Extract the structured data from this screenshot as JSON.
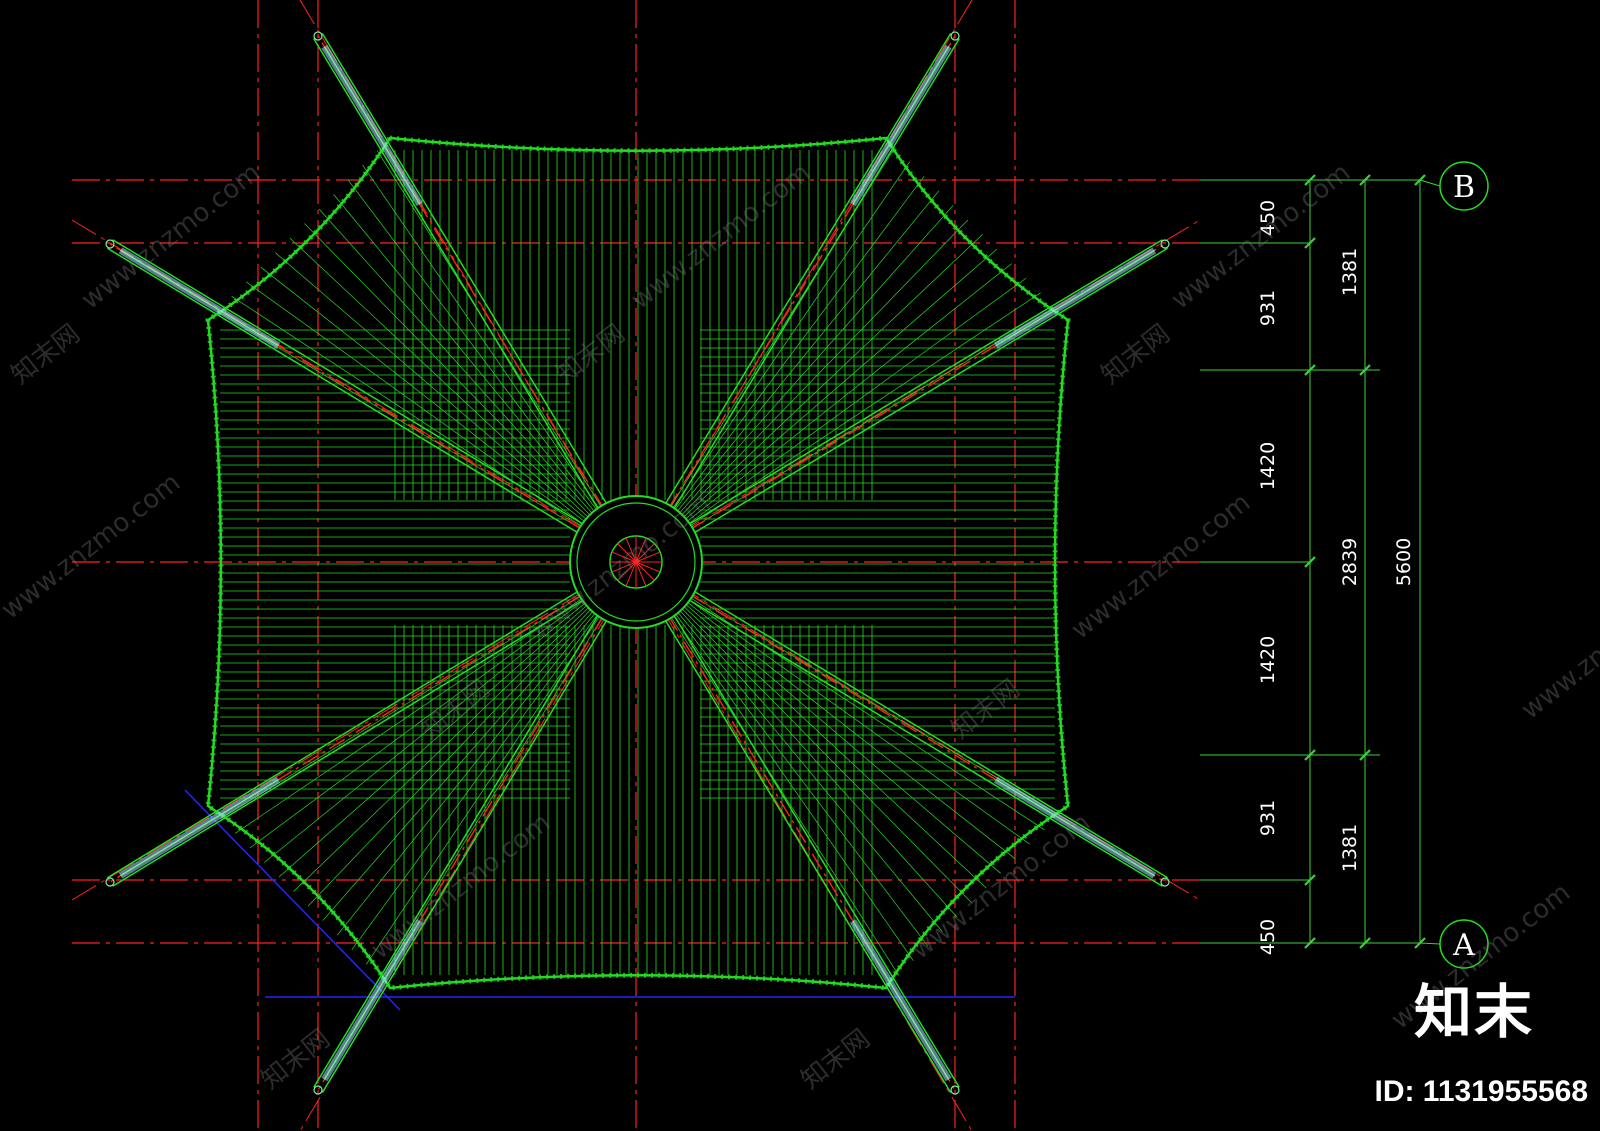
{
  "drawing": {
    "colors": {
      "background": "#000000",
      "axis": "#ff2020",
      "membrane": "#22dd22",
      "rib_edge": "#7ff0a0",
      "strut": "#9fe8ff",
      "dimension": "#3cd23c",
      "base_line": "#2424ff",
      "text": "#ffffff"
    },
    "grid_labels": {
      "top": "B",
      "bottom": "A"
    },
    "dimensions": {
      "inner": [
        "450",
        "931",
        "1420",
        "1420",
        "931",
        "450"
      ],
      "middle": [
        "1381",
        "2839",
        "1381"
      ],
      "overall": "5600"
    }
  },
  "watermark": {
    "site": "www.znzmo.com",
    "brand": "知末网"
  },
  "logo": "知末",
  "image_id": "ID: 1131955568"
}
